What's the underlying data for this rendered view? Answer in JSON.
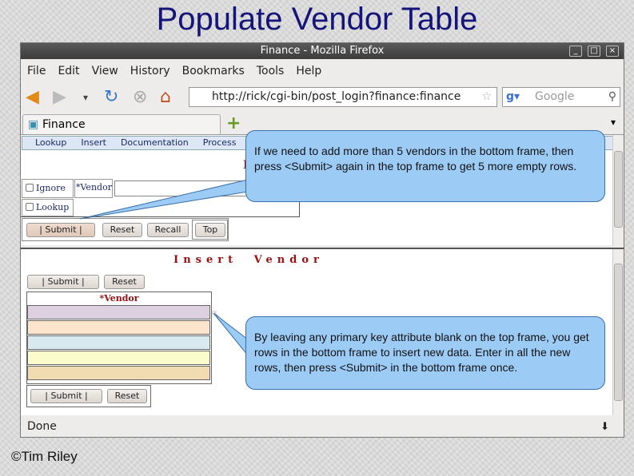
{
  "slide": {
    "title": "Populate Vendor Table",
    "copyright": "©Tim Riley"
  },
  "window": {
    "title": "Finance - Mozilla Firefox",
    "controls": [
      "_",
      "□",
      "×"
    ]
  },
  "menubar": [
    "File",
    "Edit",
    "View",
    "History",
    "Bookmarks",
    "Tools",
    "Help"
  ],
  "navbar": {
    "url": "http://rick/cgi-bin/post_login?finance:finance",
    "search_placeholder": "Google"
  },
  "tab": {
    "label": "Finance",
    "new_tab": "+"
  },
  "top_frame": {
    "menu": [
      "Lookup",
      "Insert",
      "Documentation",
      "Process"
    ],
    "heading": "I",
    "ignore_label": "Ignore",
    "lookup_label": "Lookup",
    "vendor_label": "*Vendor",
    "vendor_value": "",
    "buttons": {
      "submit": "|   Submit   |",
      "reset": "Reset",
      "recall": "Recall",
      "top": "Top"
    }
  },
  "bottom_frame": {
    "heading": "Insert Vendor",
    "vendor_header": "*Vendor",
    "row_colors": [
      "#ddd0e0",
      "#fde4cc",
      "#d8eaf0",
      "#fafccc",
      "#f0dcb0"
    ],
    "buttons": {
      "submit": "|   Submit   |",
      "reset": "Reset"
    }
  },
  "status": {
    "text": "Done"
  },
  "callouts": {
    "top": "If we need to add more than 5 vendors in the bottom frame, then press <Submit> again in the top frame to get 5 more empty rows.",
    "bottom": "By leaving any primary key attribute blank on the top frame, you get rows in the bottom frame to insert new data. Enter in all the new rows, then press <Submit> in the bottom frame once."
  }
}
